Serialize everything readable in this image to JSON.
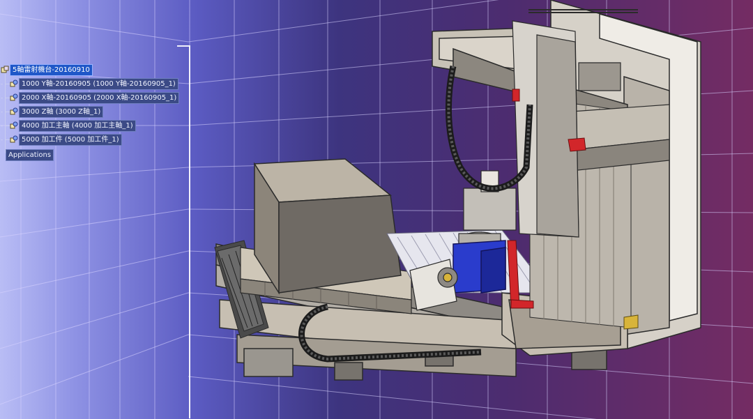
{
  "app": {
    "tree": {
      "root": {
        "label": "5軸雷射機台-20160910"
      },
      "children": [
        {
          "label": "1000 Y軸-20160905 (1000 Y軸-20160905_1)"
        },
        {
          "label": "2000 X軸-20160905 (2000 X軸-20160905_1)"
        },
        {
          "label": "3000 Z軸 (3000 Z軸_1)"
        },
        {
          "label": "4000 加工主軸 (4000 加工主軸_1)"
        },
        {
          "label": "5000 加工件 (5000 加工件_1)"
        }
      ],
      "applications": {
        "label": "Applications"
      }
    },
    "colors": {
      "bg_left": "#b9bdf5",
      "bg_right": "#742c63",
      "tree_highlight": "#1f57c8",
      "part_beige": "#c7bfb2",
      "part_grey": "#9a968f",
      "spindle_blue": "#2a3ccc",
      "bracket_red": "#d2262a",
      "motor_yellow": "#d8b43a"
    },
    "icons": [
      "product-icon",
      "part-icon",
      "expand-icon"
    ]
  }
}
